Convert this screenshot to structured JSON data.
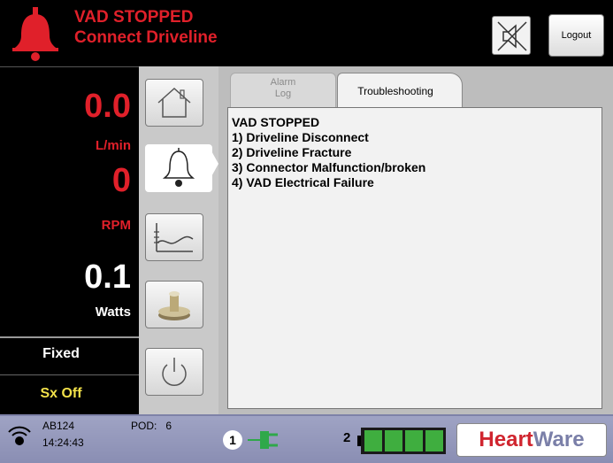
{
  "header": {
    "alarm_line1": "VAD STOPPED",
    "alarm_line2": "Connect Driveline",
    "bell_icon": "alarm-bell-icon",
    "mute_icon": "speaker-muted-icon",
    "logout_label": "Logout"
  },
  "metrics": {
    "flow_value": "0.0",
    "flow_unit": "L/min",
    "rpm_value": "0",
    "rpm_unit": "RPM",
    "power_value": "0.1",
    "power_unit": "Watts",
    "mode": "Fixed",
    "sx_status": "Sx Off"
  },
  "nav": {
    "items": [
      "home-icon",
      "alarm-bell-icon",
      "trend-chart-icon",
      "pump-icon",
      "power-icon"
    ],
    "active": "alarm-bell-icon"
  },
  "tabs": {
    "alarm_log_line1": "Alarm",
    "alarm_log_line2": "Log",
    "troubleshooting": "Troubleshooting"
  },
  "content": {
    "title": "VAD STOPPED",
    "lines": [
      "1) Driveline Disconnect",
      "2) Driveline Fracture",
      "3) Connector Malfunction/broken",
      "4) VAD Electrical Failure"
    ]
  },
  "status": {
    "device_id": "AB124",
    "time": "14:24:43",
    "pod_label": "POD:",
    "pod_value": "6",
    "port1": "1",
    "port2": "2",
    "battery_bars": 4,
    "brand_part1": "Heart",
    "brand_part2": "Ware"
  },
  "colors": {
    "alarm_red": "#e0202a",
    "sx_yellow": "#f2e14a",
    "battery_green": "#3fae3f",
    "plug_green": "#2fa84a",
    "statusbar": "#9fa3c4"
  }
}
